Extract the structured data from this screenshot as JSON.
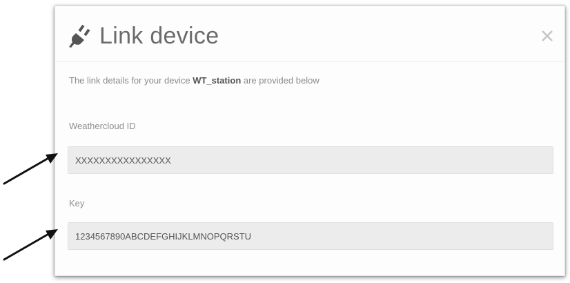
{
  "dialog": {
    "title": "Link device",
    "intro_prefix": "The link details for your device ",
    "device_name": "WT_station",
    "intro_suffix": " are provided below",
    "close_icon": "close-icon",
    "title_icon": "plug-icon"
  },
  "fields": {
    "weathercloud_id": {
      "label": "Weathercloud ID",
      "value": "XXXXXXXXXXXXXXXX"
    },
    "key": {
      "label": "Key",
      "value": "1234567890ABCDEFGHIJKLMNOPQRSTU"
    }
  },
  "annotations": {
    "arrow_icon": "arrow-icon",
    "arrow_color": "#111111"
  },
  "colors": {
    "title": "#6b6b6b",
    "input_bg": "#ececec",
    "text_muted": "#8a8a8a"
  }
}
